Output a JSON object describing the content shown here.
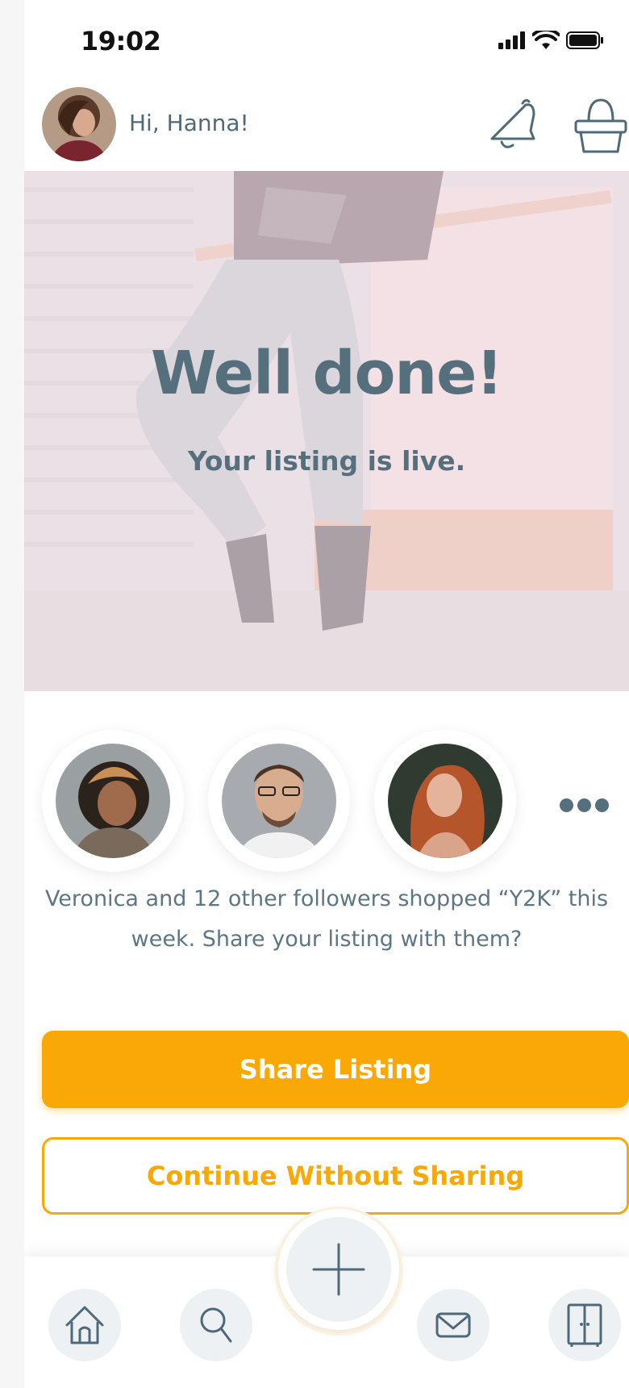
{
  "status_bar": {
    "time": "19:02"
  },
  "header": {
    "greeting": "Hi, Hanna!"
  },
  "hero": {
    "title": "Well done!",
    "subtitle": "Your listing is live."
  },
  "followers": {
    "avatars": [
      "follower-1",
      "follower-2",
      "follower-3"
    ],
    "message": "Veronica and 12 other followers shopped “Y2K” this week. Share your listing with them?"
  },
  "actions": {
    "share_label": "Share Listing",
    "continue_label": "Continue Without Sharing"
  },
  "nav": {
    "icons": [
      "home-icon",
      "search-icon",
      "plus-icon",
      "mail-icon",
      "wardrobe-icon"
    ]
  },
  "colors": {
    "accent": "#f9a806",
    "text": "#4e6a7a",
    "hero_text": "#566f7c",
    "nav_bg": "#eef1f3"
  }
}
